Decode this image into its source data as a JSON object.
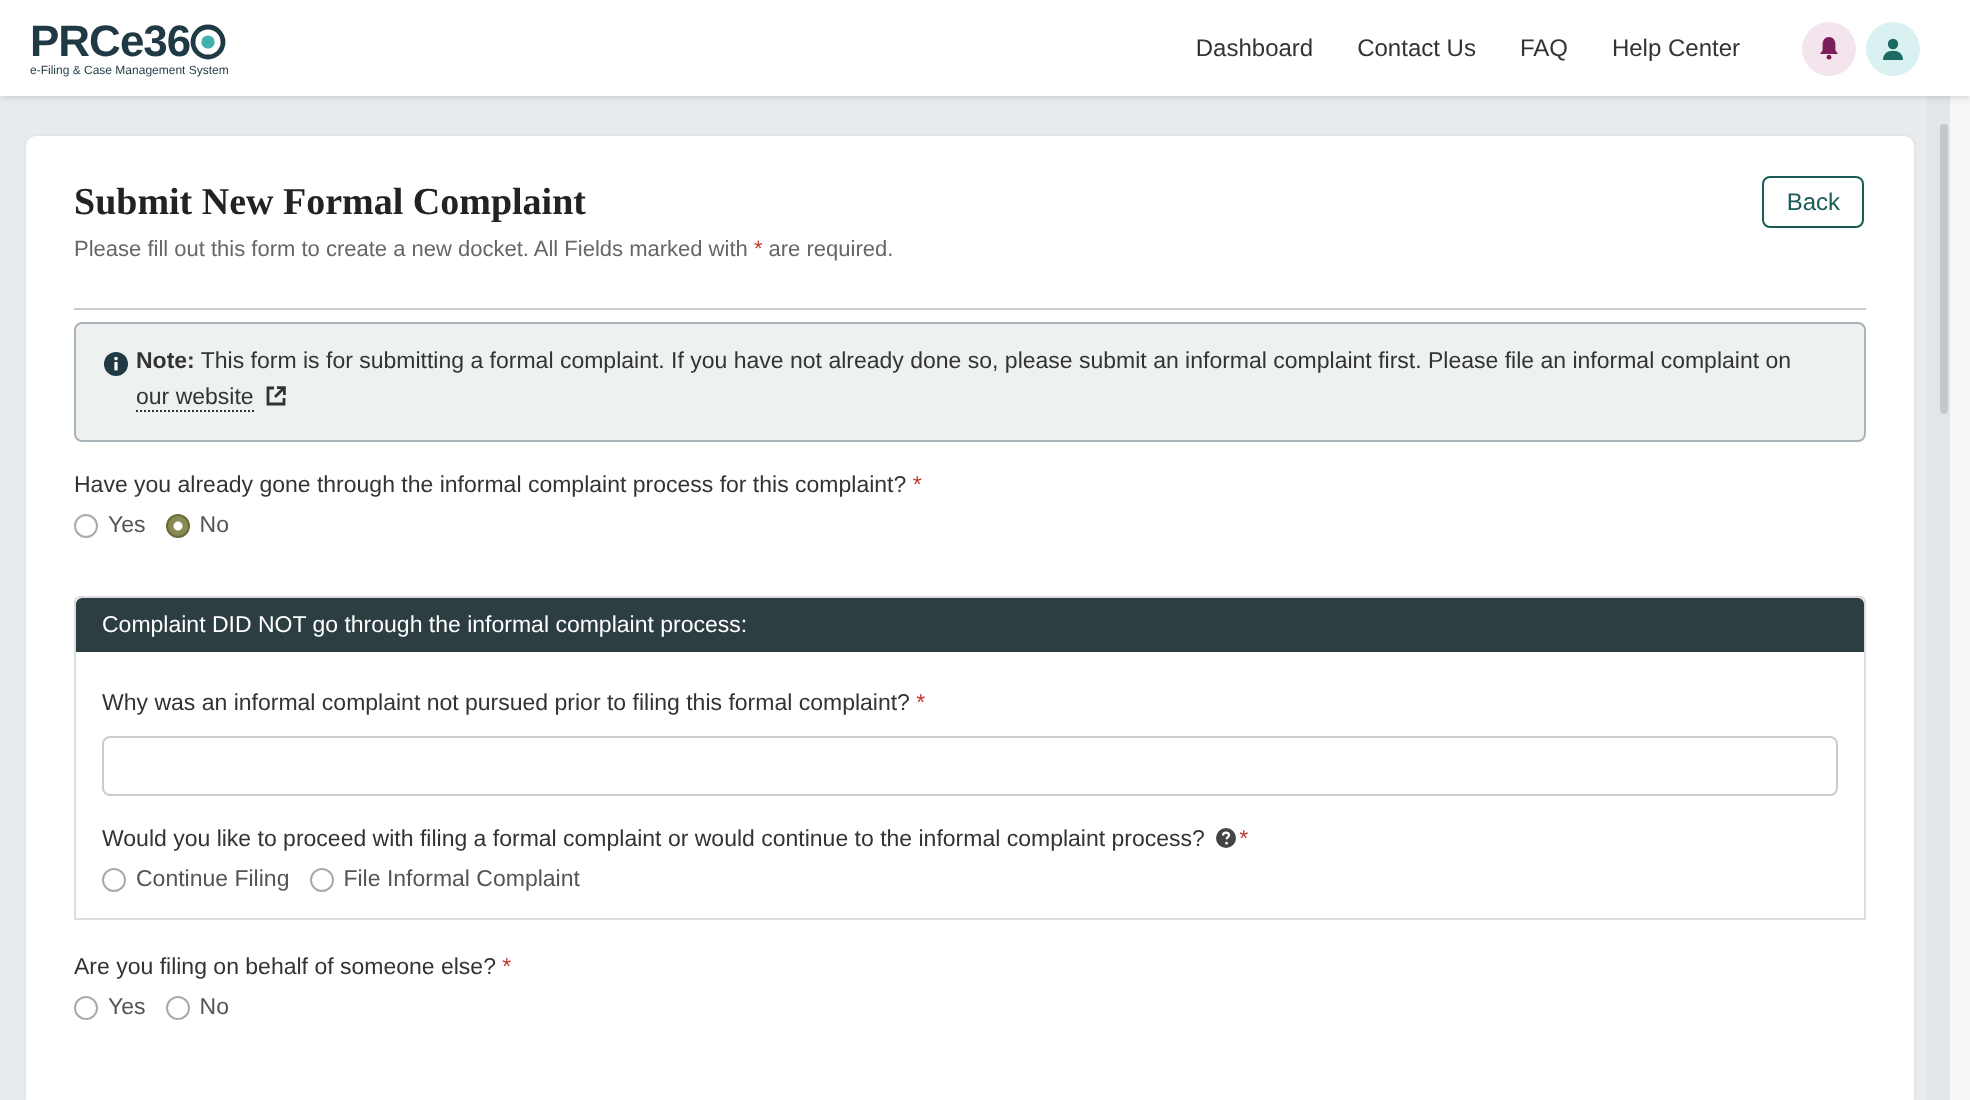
{
  "header": {
    "logo": {
      "name": "PRCe36",
      "tagline": "e-Filing & Case Management System"
    },
    "nav": [
      {
        "label": "Dashboard"
      },
      {
        "label": "Contact Us"
      },
      {
        "label": "FAQ"
      },
      {
        "label": "Help Center"
      }
    ]
  },
  "form": {
    "title": "Submit New Formal Complaint",
    "subtitle": {
      "before": "Please fill out this form to create a new docket. All Fields marked with",
      "mark": "*",
      "after": "are required."
    },
    "back_button": "Back",
    "note": {
      "text": "**Note:** This form is for submitting a formal complaint. If you have not already done so, please submit an informal complaint first. Please file an informal complaint on",
      "link": "our website"
    },
    "questions": [
      {
        "kind": "radio",
        "label": "Have you already gone through the informal complaint process for this complaint?",
        "required_mark": "*",
        "options": [
          {
            "label": "Yes",
            "selected": false
          },
          {
            "label": "No",
            "selected": true
          }
        ]
      },
      {
        "kind": "panel",
        "title": "Complaint DID NOT go through the informal complaint process:",
        "questions": [
          {
            "kind": "text",
            "label": "Why was an informal complaint not pursued prior to filing this formal complaint?",
            "required_mark": "*"
          },
          {
            "kind": "radio",
            "label": "Would you like to proceed with filing a formal complaint or would continue to the informal complaint process?",
            "help": true,
            "required_mark": "*",
            "options": [
              {
                "label": "Continue Filing",
                "selected": false
              },
              {
                "label": "File Informal Complaint",
                "selected": false
              }
            ]
          }
        ]
      },
      {
        "kind": "radio",
        "label": "Are you filing on behalf of someone else?",
        "required_mark": "*",
        "options": [
          {
            "label": "Yes",
            "selected": false
          },
          {
            "label": "No",
            "selected": false
          }
        ]
      }
    ]
  }
}
